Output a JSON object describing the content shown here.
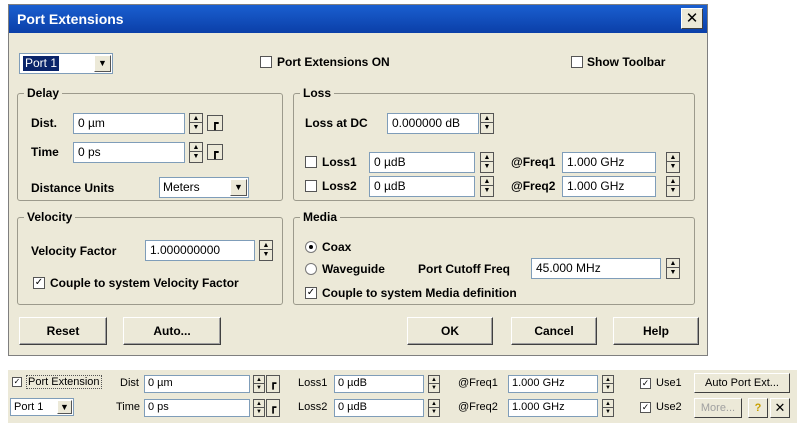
{
  "dialog": {
    "title": "Port Extensions",
    "port_select": "Port 1",
    "port_extensions_on": "Port Extensions ON",
    "show_toolbar": "Show Toolbar",
    "delay": {
      "title": "Delay",
      "dist_label": "Dist.",
      "dist_value": "0 µm",
      "time_label": "Time",
      "time_value": "0 ps",
      "units_label": "Distance Units",
      "units_value": "Meters"
    },
    "loss": {
      "title": "Loss",
      "dc_label": "Loss at DC",
      "dc_value": "0.000000 dB",
      "loss1_label": "Loss1",
      "loss1_value": "0 µdB",
      "loss2_label": "Loss2",
      "loss2_value": "0 µdB",
      "freq1_label": "@Freq1",
      "freq1_value": "1.000 GHz",
      "freq2_label": "@Freq2",
      "freq2_value": "1.000 GHz"
    },
    "velocity": {
      "title": "Velocity",
      "factor_label": "Velocity Factor",
      "factor_value": "1.000000000",
      "couple_label": "Couple to system Velocity Factor"
    },
    "media": {
      "title": "Media",
      "coax": "Coax",
      "waveguide": "Waveguide",
      "cutoff_label": "Port Cutoff Freq",
      "cutoff_value": "45.000 MHz",
      "couple_label": "Couple to system Media definition"
    },
    "buttons": {
      "reset": "Reset",
      "auto": "Auto...",
      "ok": "OK",
      "cancel": "Cancel",
      "help": "Help"
    }
  },
  "toolbar": {
    "port_extension": "Port Extension",
    "port_select": "Port 1",
    "dist_label": "Dist",
    "dist_value": "0 µm",
    "time_label": "Time",
    "time_value": "0 ps",
    "loss1_label": "Loss1",
    "loss1_value": "0 µdB",
    "loss2_label": "Loss2",
    "loss2_value": "0 µdB",
    "freq1_label": "@Freq1",
    "freq1_value": "1.000 GHz",
    "freq2_label": "@Freq2",
    "freq2_value": "1.000 GHz",
    "use1": "Use1",
    "use2": "Use2",
    "auto_port_ext": "Auto Port Ext...",
    "more": "More..."
  }
}
